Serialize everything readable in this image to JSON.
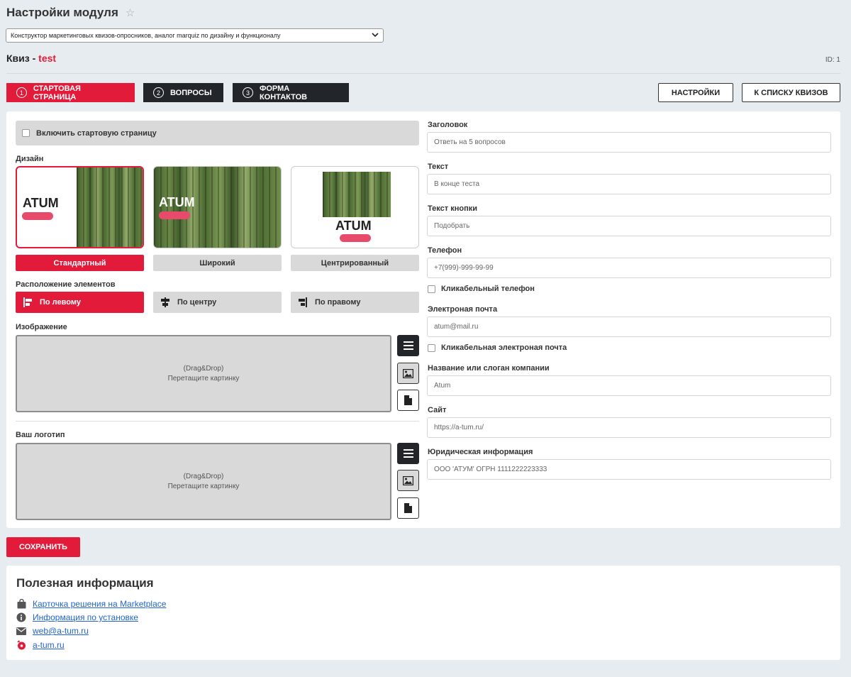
{
  "header": {
    "title": "Настройки модуля",
    "module_select": "Конструктор маркетинговых квизов-опросников, аналог marquiz по дизайну и функционалу"
  },
  "quiz": {
    "label": "Квиз - ",
    "name": "test",
    "id": "ID: 1"
  },
  "tabs": [
    {
      "num": "1",
      "label": "Стартовая страница"
    },
    {
      "num": "2",
      "label": "Вопросы"
    },
    {
      "num": "3",
      "label": "Форма контактов"
    }
  ],
  "actions": {
    "settings": "НАСТРОЙКИ",
    "to_list": "К СПИСКУ КВИЗОВ"
  },
  "left": {
    "enable_start": "Включить стартовую страницу",
    "design_label": "Дизайн",
    "design_preview_text": "ATUM",
    "designs": [
      "Стандартный",
      "Широкий",
      "Центрированный"
    ],
    "align_label": "Расположение элементов",
    "aligns": [
      "По левому",
      "По центру",
      "По правому"
    ],
    "image_label": "Изображение",
    "logo_label": "Ваш логотип",
    "drop_line1": "(Drag&Drop)",
    "drop_line2": "Перетащите картинку"
  },
  "right": {
    "heading_label": "Заголовок",
    "heading_value": "Ответь на 5 вопросов",
    "text_label": "Текст",
    "text_value": "В конце теста",
    "button_label": "Текст кнопки",
    "button_value": "Подобрать",
    "phone_label": "Телефон",
    "phone_value": "+7(999)-999-99-99",
    "phone_clickable": "Кликабельный телефон",
    "email_label": "Электроная почта",
    "email_value": "atum@mail.ru",
    "email_clickable": "Кликабельная электроная почта",
    "company_label": "Название или слоган компании",
    "company_value": "Atum",
    "site_label": "Сайт",
    "site_value": "https://a-tum.ru/",
    "legal_label": "Юридическая информация",
    "legal_value": "ООО 'АТУМ' ОГРН 1111222223333"
  },
  "save": "СОХРАНИТЬ",
  "info": {
    "title": "Полезная информация",
    "links": [
      "Карточка решения на Marketplace",
      "Информация по установке",
      "web@a-tum.ru",
      "a-tum.ru"
    ]
  },
  "colors": {
    "accent": "#e31b3b",
    "dark": "#22252a"
  }
}
